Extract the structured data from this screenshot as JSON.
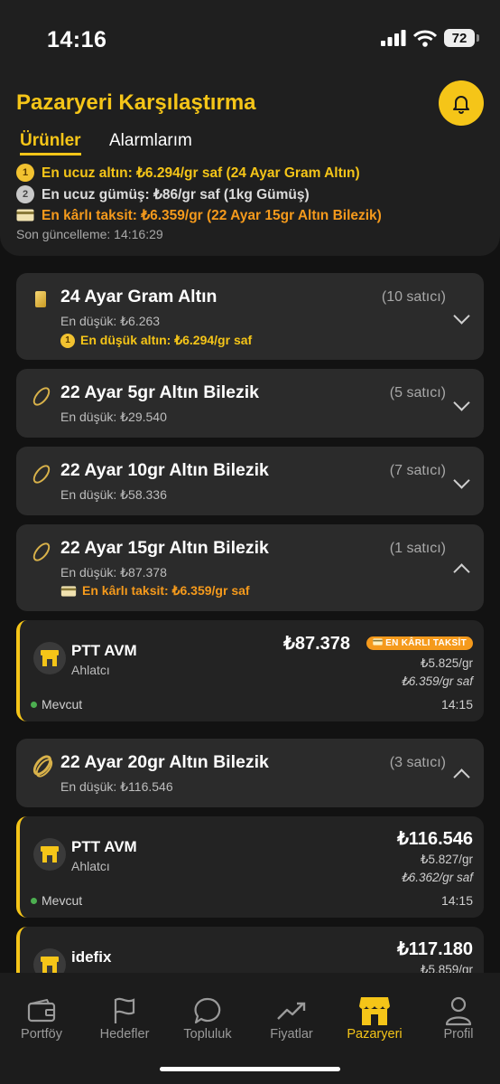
{
  "status_bar": {
    "time": "14:16",
    "battery": "72"
  },
  "header": {
    "title": "Pazaryeri Karşılaştırma",
    "tabs": [
      {
        "label": "Ürünler",
        "active": true
      },
      {
        "label": "Alarmlarım",
        "active": false
      }
    ],
    "cheapest_gold": "En ucuz altın: ₺6.294/gr saf (24 Ayar Gram Altın)",
    "cheapest_silver": "En ucuz gümüş: ₺86/gr saf (1kg Gümüş)",
    "best_installment": "En kârlı taksit: ₺6.359/gr (22 Ayar 15gr Altın Bilezik)",
    "last_update": "Son güncelleme: 14:16:29",
    "colors": {
      "accent": "#f5c518",
      "orange": "#f59a1c",
      "green": "#4caf50"
    }
  },
  "products": [
    {
      "title": "24 Ayar Gram Altın",
      "count": "(10 satıcı)",
      "min": "En düşük: ₺6.263",
      "tip": "En düşük altın: ₺6.294/gr saf",
      "icon": "gold-bar-icon",
      "expanded": false
    },
    {
      "title": "22 Ayar 5gr Altın Bilezik",
      "count": "(5 satıcı)",
      "min": "En düşük: ₺29.540",
      "icon": "bracelet-icon",
      "expanded": false
    },
    {
      "title": "22 Ayar 10gr Altın Bilezik",
      "count": "(7 satıcı)",
      "min": "En düşük: ₺58.336",
      "icon": "bracelet-icon",
      "expanded": false
    },
    {
      "title": "22 Ayar 15gr Altın Bilezik",
      "count": "(1 satıcı)",
      "min": "En düşük: ₺87.378",
      "tip": "En kârlı taksit: ₺6.359/gr saf",
      "icon": "bracelet-icon",
      "expanded": true
    },
    {
      "title": "22 Ayar 20gr Altın Bilezik",
      "count": "(3 satıcı)",
      "min": "En düşük: ₺116.546",
      "icon": "bracelet-icon",
      "expanded": true
    }
  ],
  "sellers": [
    {
      "name": "PTT AVM",
      "sub": "Ahlatcı",
      "price": "₺87.378",
      "badge": "EN KÂRLI TAKSİT",
      "per_gram": "₺5.825/gr",
      "per_gram_pure": "₺6.359/gr saf",
      "status": "Mevcut",
      "time": "14:15"
    },
    {
      "name": "PTT AVM",
      "sub": "Ahlatcı",
      "price": "₺116.546",
      "per_gram": "₺5.827/gr",
      "per_gram_pure": "₺6.362/gr saf",
      "status": "Mevcut",
      "time": "14:15"
    },
    {
      "name": "idefix",
      "price": "₺117.180",
      "per_gram": "₺5.859/gr"
    }
  ],
  "tabbar": [
    {
      "label": "Portföy",
      "icon": "wallet-icon"
    },
    {
      "label": "Hedefler",
      "icon": "flag-icon"
    },
    {
      "label": "Topluluk",
      "icon": "chat-bubble-icon"
    },
    {
      "label": "Fiyatlar",
      "icon": "trend-up-icon"
    },
    {
      "label": "Pazaryeri",
      "icon": "store-icon",
      "active": true
    },
    {
      "label": "Profil",
      "icon": "person-icon"
    }
  ]
}
